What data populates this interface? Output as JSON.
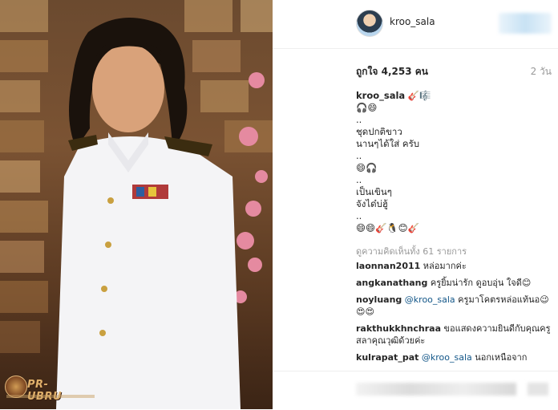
{
  "post": {
    "username": "kroo_sala",
    "likes_text": "ถูกใจ 4,253 คน",
    "date_text": "2 วัน",
    "caption_lines": [
      "🎸🎼",
      "🎧😄",
      "..",
      "ชุดปกติขาว",
      "นานๆได้ใส่ ครับ",
      "..",
      "😄🎧",
      "..",
      "เป็นเขินๆ",
      "จังได๋บ่ฮู้",
      "..",
      "😄😄🎸🐧😊🎸"
    ],
    "all_comments": "ดูความคิดเห็นทั้ง 61 รายการ"
  },
  "comments": [
    {
      "user": "laonnan2011",
      "text": " หล่อมากค่ะ"
    },
    {
      "user": "angkanathang",
      "text": " ครูยิ้มน่ารัก ดูอบอุ่น ใจดี😊"
    },
    {
      "user": "noyluang",
      "mention": " @kroo_sala",
      "text": " ครูมาโคตรหล่อแท้นอ😉😍😍"
    },
    {
      "user": "rakthukkhnchraa",
      "text": " ขอแสดงความยินดีกับคุณครูสลาคุณวุฒิด้วยค่ะ"
    },
    {
      "user": "kulrapat_pat",
      "mention": " @kroo_sala",
      "text": " นอกเหนือจาก"
    }
  ],
  "watermark": {
    "text": "PR-UBRU"
  },
  "colors": {
    "mention": "#125688",
    "muted": "#999999",
    "text": "#262626"
  }
}
